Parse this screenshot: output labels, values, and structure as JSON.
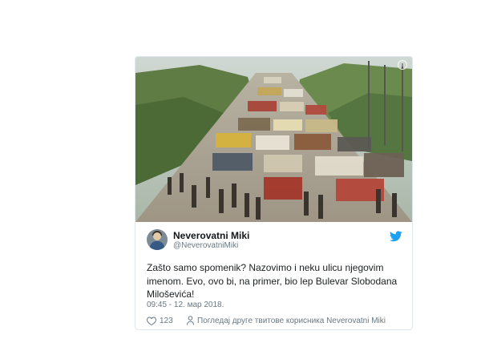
{
  "tweet": {
    "author": {
      "display_name": "Neverovatni Miki",
      "handle": "@NeverovatniMiki"
    },
    "text": "Zašto samo spomenik? Nazovimo i neku ulicu njegovim imenom. Evo, ovo bi, na primer, bio lep Bulevar Slobodana Miloševića!",
    "timestamp": "09:45 - 12. мар 2018.",
    "likes": "123",
    "more_tweets_label": "Погледај друге твитове корисника Neverovatni Miki",
    "media_info_glyph": "i"
  },
  "icons": {
    "twitter": "twitter-bird-icon",
    "like": "heart-icon",
    "people": "person-icon",
    "info": "info-icon"
  },
  "colors": {
    "twitter_blue": "#1da1f2",
    "secondary_text": "#697882",
    "card_border": "#e1e8ed"
  }
}
